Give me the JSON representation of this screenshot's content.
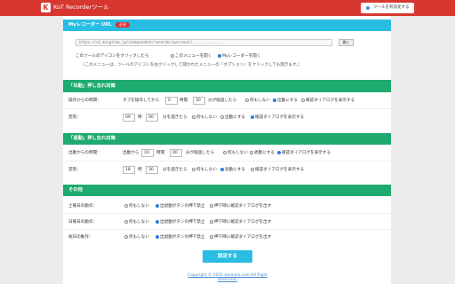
{
  "app": {
    "title": "KoT Recorderツール",
    "logo_letter": "K",
    "enable_button": "ツールを有効化する",
    "accent": "#d7372f"
  },
  "url_section": {
    "heading": "Myレコーダー URL",
    "badge": "必須",
    "url_value": "https://s2.kingtime.jp/independent/recorder/personal/..............",
    "open_button": "開く",
    "click_prompt": "このツールのアイコンをクリックしたら",
    "click_options": [
      "このメニューを開く",
      "Myレコーダーを開く"
    ],
    "click_selected": 1,
    "note": "（このメニューは、ツールのアイコンを右クリックして開かれたメニューの『オプション』をクリックしても開きます。）"
  },
  "clock_in": {
    "heading": "「出勤」押し忘れ対策",
    "op_label": "操作からの時間：",
    "op_prefix": "タブを操作してから",
    "op_hours": "0",
    "op_hours_unit": "時間",
    "op_minutes": "30",
    "op_minutes_suffix": "分が経過したら",
    "op_options": [
      "何もしない",
      "出勤にする",
      "確認ダイアログを表示する"
    ],
    "op_selected": 1,
    "fixed_label": "定刻：",
    "fixed_hour": "09",
    "fixed_hour_unit": "時",
    "fixed_minute": "00",
    "fixed_suffix": "分を過ぎたら",
    "fixed_options": [
      "何もしない",
      "出勤にする",
      "確認ダイアログを表示する"
    ],
    "fixed_selected": 2
  },
  "clock_out": {
    "heading": "「退勤」押し忘れ対策",
    "op_label": "出勤からの時間：",
    "op_prefix": "出勤から",
    "op_hours": "10",
    "op_hours_unit": "時間",
    "op_minutes": "00",
    "op_minutes_suffix": "分が経過したら",
    "op_options": [
      "何もしない",
      "退勤にする",
      "確認ダイアログを表示する"
    ],
    "op_selected": 2,
    "fixed_label": "定刻：",
    "fixed_hour": "18",
    "fixed_hour_unit": "時",
    "fixed_minute": "30",
    "fixed_suffix": "分を過ぎたら",
    "fixed_options": [
      "何もしない",
      "退勤にする",
      "確認ダイアログを表示する"
    ],
    "fixed_selected": 1
  },
  "other": {
    "heading": "その他",
    "rows": [
      {
        "label": "土曜日の動作：",
        "options": [
          "何もしない",
          "出退勤ボタンの押下禁止",
          "押下時に確認ダイアログを出す"
        ],
        "selected": 1
      },
      {
        "label": "日曜日の動作：",
        "options": [
          "何もしない",
          "出退勤ボタンの押下禁止",
          "押下時に確認ダイアログを出す"
        ],
        "selected": 1
      },
      {
        "label": "祝日の動作：",
        "options": [
          "何もしない",
          "出退勤ボタンの押下禁止",
          "押下時に確認ダイアログを出す"
        ],
        "selected": 1
      }
    ]
  },
  "submit_label": "設定する",
  "footer": "Copyright © 2022 doranka.com All Right Reserved."
}
